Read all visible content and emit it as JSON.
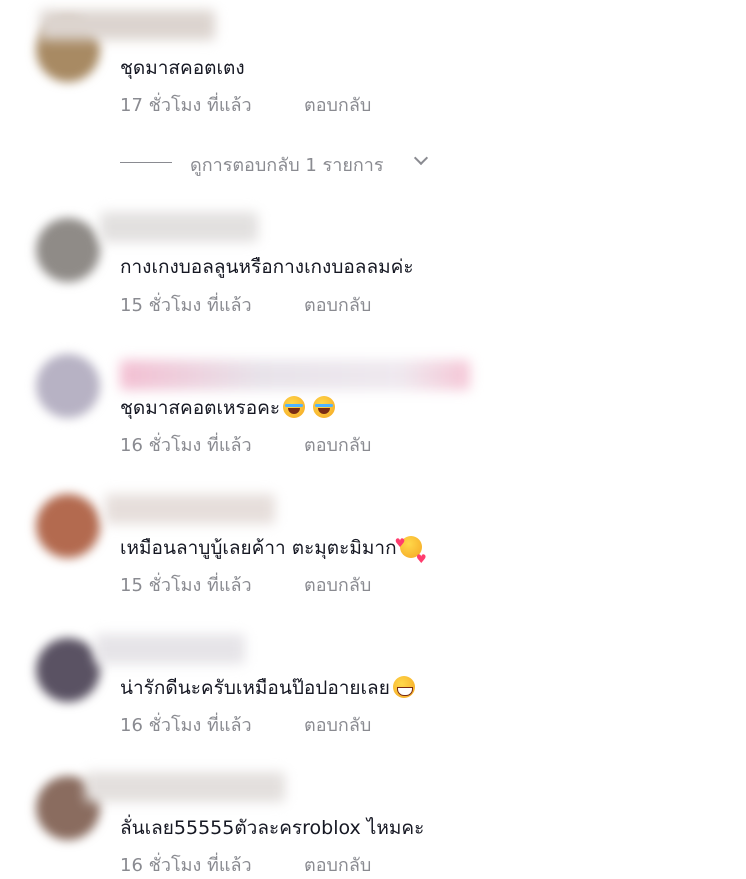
{
  "comments": [
    {
      "text": "ชุดมาสคอตเตง",
      "time": "17 ชั่วโมง ที่แล้ว",
      "reply": "ตอบกลับ",
      "view_replies": "ดูการตอบกลับ 1 รายการ"
    },
    {
      "text": "กางเกงบอลลูนหรือกางเกงบอลลมค่ะ",
      "time": "15 ชั่วโมง ที่แล้ว",
      "reply": "ตอบกลับ"
    },
    {
      "text": "ชุดมาสคอตเหรอคะ",
      "time": "16 ชั่วโมง ที่แล้ว",
      "reply": "ตอบกลับ"
    },
    {
      "text": "เหมือนลาบูบู้เลยค้าา ตะมุตะมิมาก",
      "time": "15 ชั่วโมง ที่แล้ว",
      "reply": "ตอบกลับ"
    },
    {
      "text": "น่ารักดีนะครับเหมือนป๊อปอายเลย",
      "time": "16 ชั่วโมง ที่แล้ว",
      "reply": "ตอบกลับ"
    },
    {
      "text": "ลั่นเลย55555ตัวละครroblox ไหมคะ",
      "time": "16 ชั่วโมง ที่แล้ว",
      "reply": "ตอบกลับ"
    }
  ],
  "emoji": {
    "c3": [
      "face-tears-of-joy-emoji",
      "face-tears-of-joy-emoji"
    ],
    "c4": [
      "smiling-face-with-hearts-emoji"
    ],
    "c5": [
      "grinning-face-emoji"
    ]
  }
}
